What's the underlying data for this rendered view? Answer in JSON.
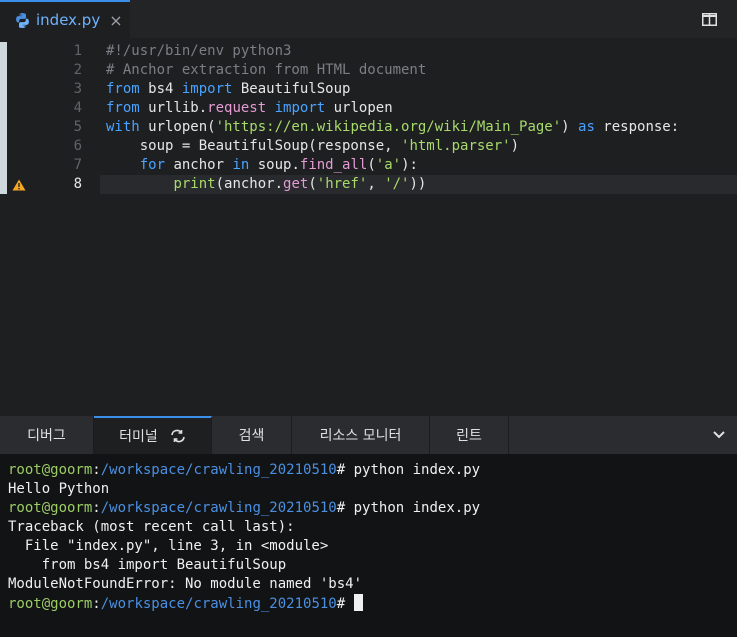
{
  "tab": {
    "filename": "index.py",
    "close": "×"
  },
  "editor": {
    "current_line": 8,
    "lines": [
      {
        "n": "1",
        "text": "#!/usr/bin/env python3"
      },
      {
        "n": "2",
        "text": "# Anchor extraction from HTML document"
      },
      {
        "n": "3",
        "text": "from bs4 import BeautifulSoup"
      },
      {
        "n": "4",
        "text": "from urllib.request import urlopen"
      },
      {
        "n": "5",
        "text": "with urlopen('https://en.wikipedia.org/wiki/Main_Page') as response:"
      },
      {
        "n": "6",
        "text": "    soup = BeautifulSoup(response, 'html.parser')"
      },
      {
        "n": "7",
        "text": "    for anchor in soup.find_all('a'):"
      },
      {
        "n": "8",
        "text": "        print(anchor.get('href', '/'))"
      }
    ],
    "warning_line": 8
  },
  "panel": {
    "tabs": [
      {
        "label": "디버그",
        "active": false
      },
      {
        "label": "터미널",
        "active": true
      },
      {
        "label": "검색",
        "active": false
      },
      {
        "label": "리소스 모니터",
        "active": false
      },
      {
        "label": "린트",
        "active": false
      }
    ]
  },
  "terminal": {
    "user": "root@goorm",
    "path": "/workspace/crawling_20210510",
    "prompt_suffix": "#",
    "cmd1": " python index.py",
    "out1": "Hello Python",
    "cmd2": " python index.py",
    "out2": [
      "Traceback (most recent call last):",
      "  File \"index.py\", line 3, in <module>",
      "    from bs4 import BeautifulSoup",
      "ModuleNotFoundError: No module named 'bs4'"
    ]
  },
  "colors": {
    "accent": "#3b8eea",
    "keyword": "#4aa3ff",
    "string": "#a8d96b",
    "comment": "#7b7f84",
    "warning": "#f5a623"
  }
}
